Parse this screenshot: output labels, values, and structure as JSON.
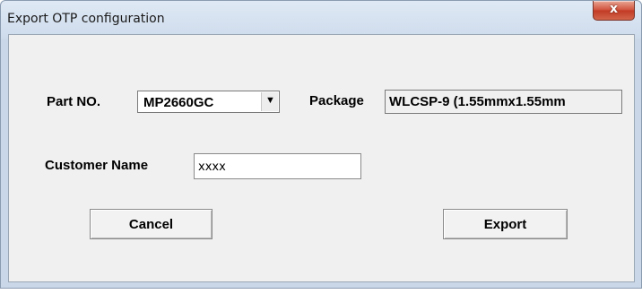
{
  "window": {
    "title": "Export OTP configuration",
    "close_label": "x"
  },
  "form": {
    "part_label": "Part NO.",
    "part_value": "MP2660GC",
    "package_label": "Package",
    "package_value": "WLCSP-9 (1.55mmx1.55mm",
    "customer_label": "Customer Name",
    "customer_value": "xxxx"
  },
  "buttons": {
    "cancel": "Cancel",
    "export": "Export"
  },
  "icons": {
    "dropdown": "chevron-down-icon",
    "close": "close-icon"
  }
}
